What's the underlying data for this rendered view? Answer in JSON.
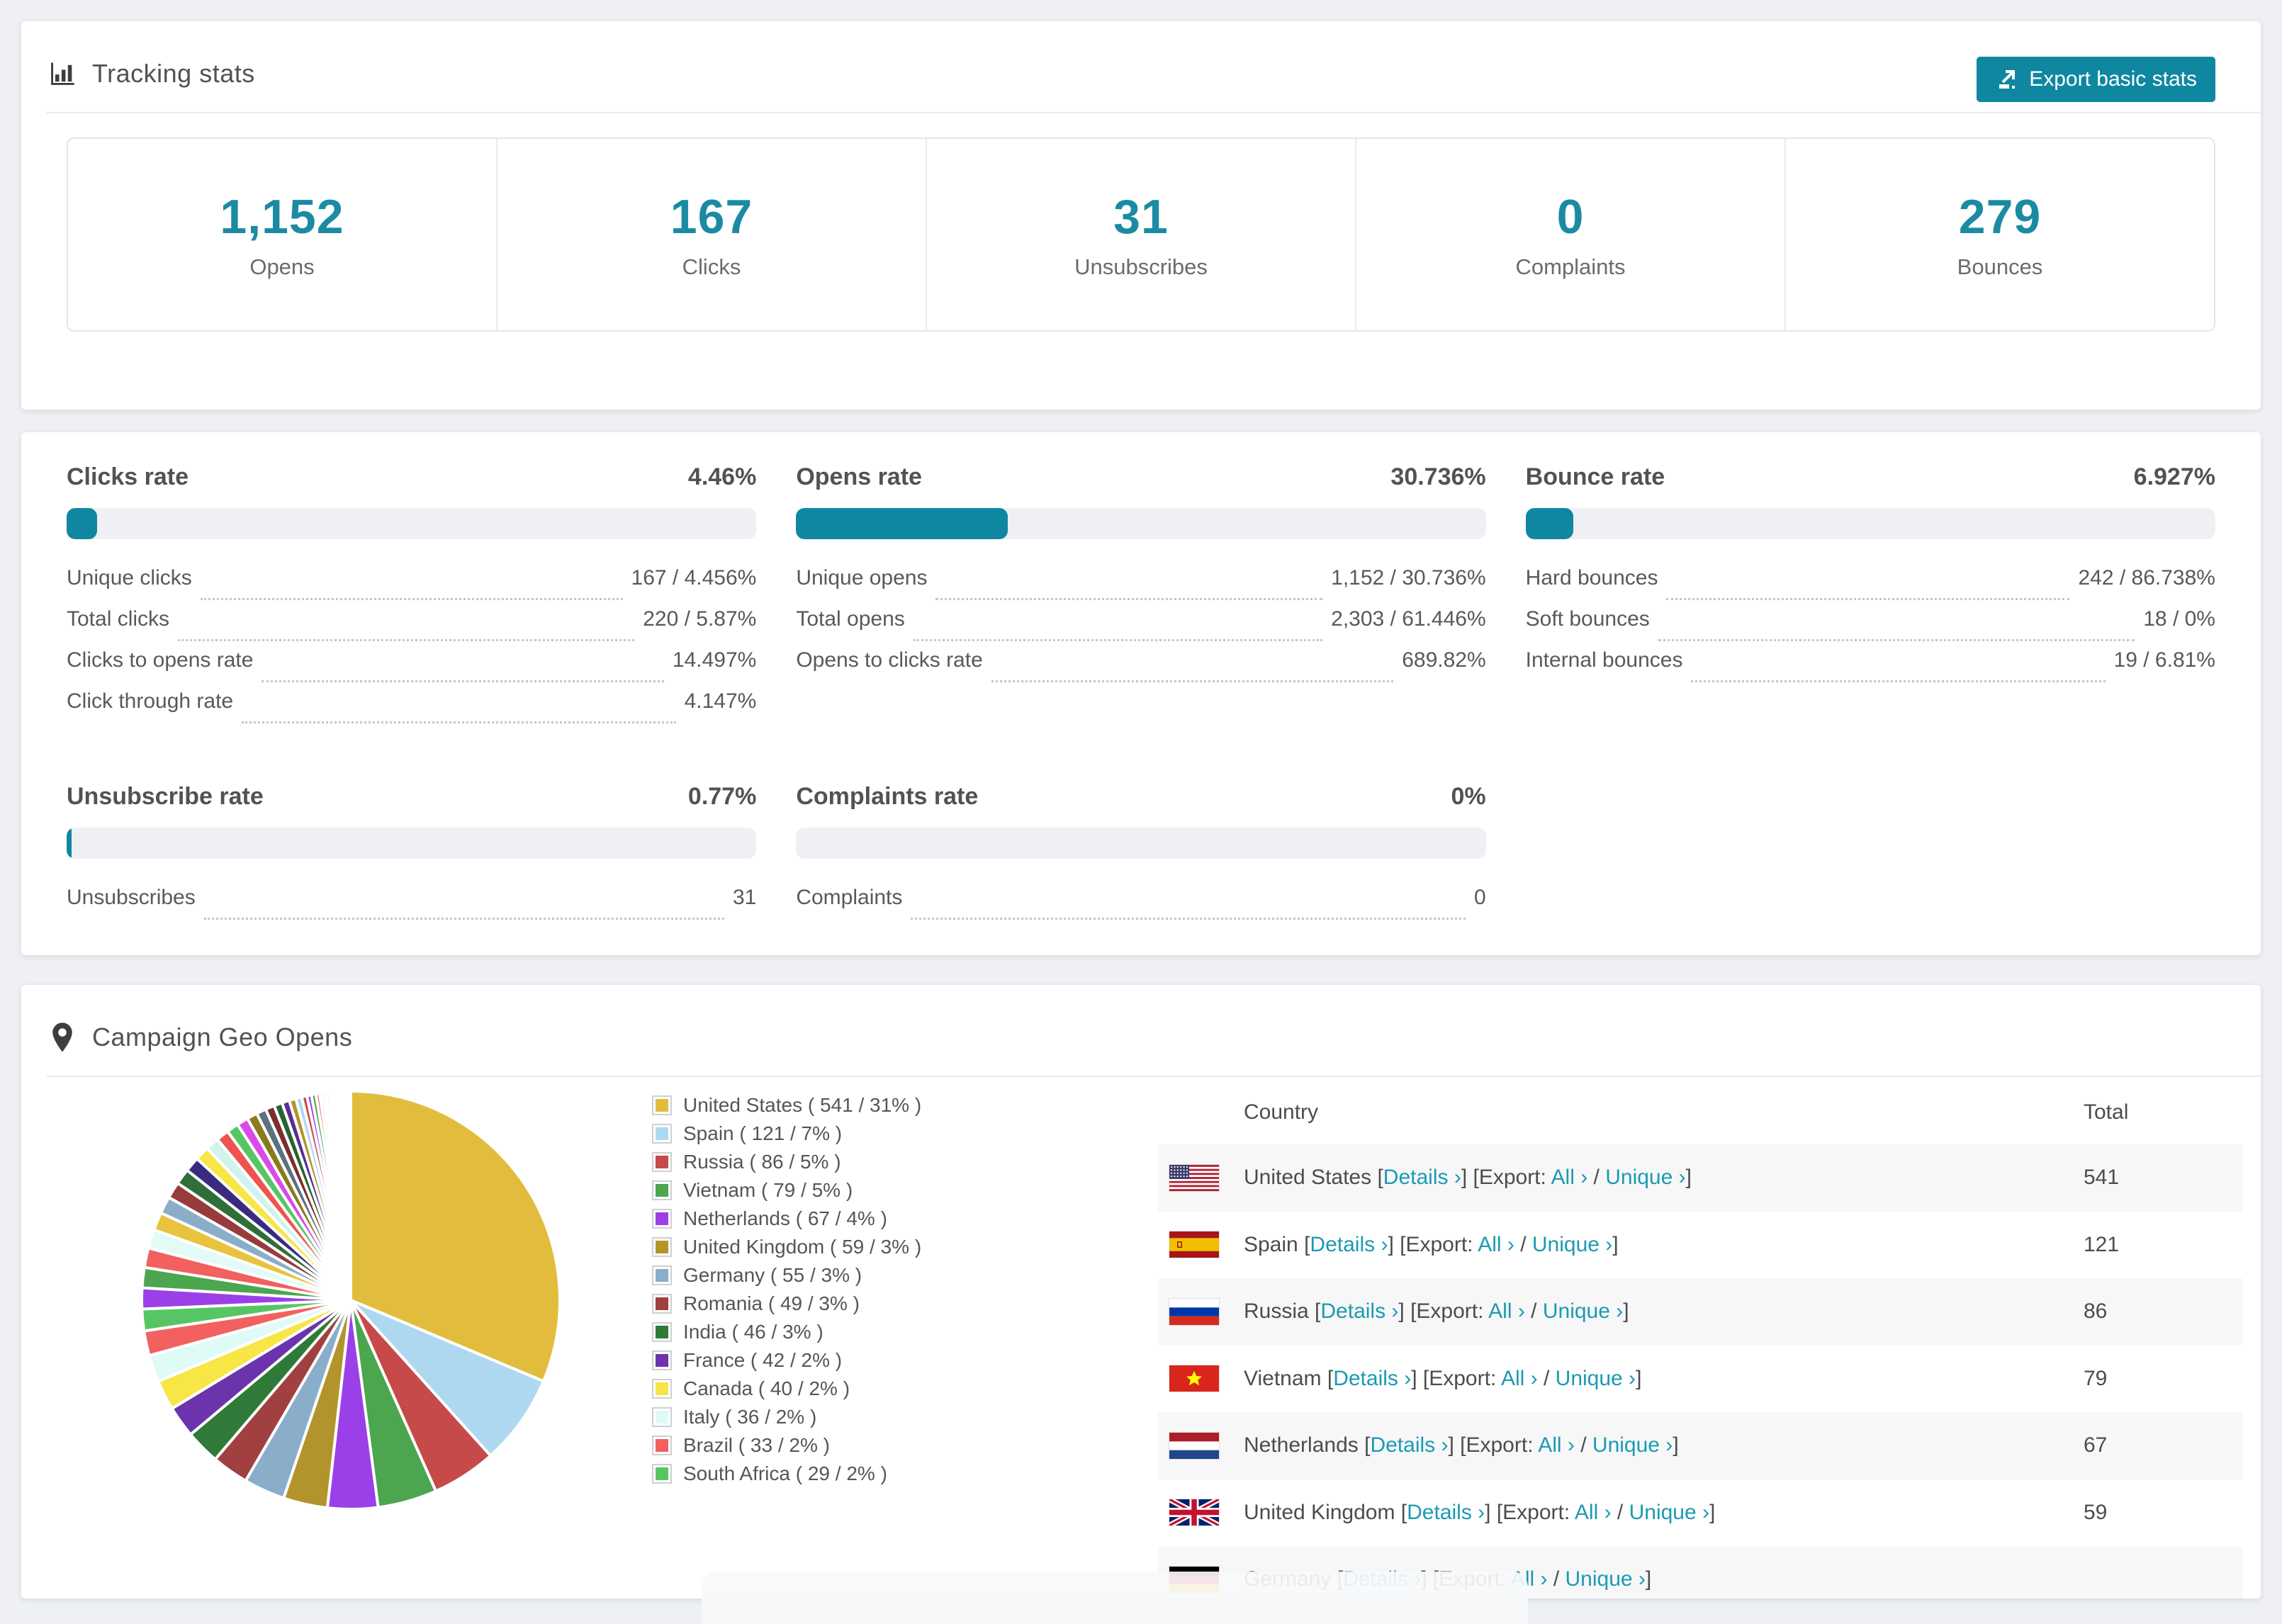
{
  "accent_color": "#0f87a1",
  "link_color": "#1b9ab3",
  "tracking": {
    "title": "Tracking stats",
    "export_button": "Export basic stats",
    "stats": [
      {
        "value": "1,152",
        "label": "Opens"
      },
      {
        "value": "167",
        "label": "Clicks"
      },
      {
        "value": "31",
        "label": "Unsubscribes"
      },
      {
        "value": "0",
        "label": "Complaints"
      },
      {
        "value": "279",
        "label": "Bounces"
      }
    ]
  },
  "rates": {
    "blocks": [
      {
        "id": "clicks-rate",
        "title": "Clicks rate",
        "value": "4.46%",
        "bar_percent": 4.46,
        "rows": [
          {
            "label": "Unique clicks",
            "value": "167 / 4.456%"
          },
          {
            "label": "Total clicks",
            "value": "220 / 5.87%"
          },
          {
            "label": "Clicks to opens rate",
            "value": "14.497%"
          },
          {
            "label": "Click through rate",
            "value": "4.147%"
          }
        ]
      },
      {
        "id": "opens-rate",
        "title": "Opens rate",
        "value": "30.736%",
        "bar_percent": 30.736,
        "rows": [
          {
            "label": "Unique opens",
            "value": "1,152 / 30.736%"
          },
          {
            "label": "Total opens",
            "value": "2,303 / 61.446%"
          },
          {
            "label": "Opens to clicks rate",
            "value": "689.82%"
          }
        ]
      },
      {
        "id": "bounce-rate",
        "title": "Bounce rate",
        "value": "6.927%",
        "bar_percent": 6.927,
        "rows": [
          {
            "label": "Hard bounces",
            "value": "242 / 86.738%"
          },
          {
            "label": "Soft bounces",
            "value": "18 / 0%"
          },
          {
            "label": "Internal bounces",
            "value": "19 / 6.81%"
          }
        ]
      },
      {
        "id": "unsubscribe-rate",
        "title": "Unsubscribe rate",
        "value": "0.77%",
        "bar_percent": 0.77,
        "rows": [
          {
            "label": "Unsubscribes",
            "value": "31"
          }
        ]
      },
      {
        "id": "complaints-rate",
        "title": "Complaints rate",
        "value": "0%",
        "bar_percent": 0,
        "rows": [
          {
            "label": "Complaints",
            "value": "0"
          }
        ]
      }
    ]
  },
  "geo": {
    "title": "Campaign Geo Opens",
    "chart_data": {
      "type": "pie",
      "title": "Campaign Geo Opens",
      "legend_position": "right",
      "start_angle_deg": 0,
      "direction": "clockwise",
      "slices": [
        {
          "label": "United States",
          "value": 541,
          "pct": "31%",
          "color": "#e2bd3d",
          "flag": "us"
        },
        {
          "label": "Spain",
          "value": 121,
          "pct": "7%",
          "color": "#aed8f0",
          "flag": "es"
        },
        {
          "label": "Russia",
          "value": 86,
          "pct": "5%",
          "color": "#c64a4a",
          "flag": "ru"
        },
        {
          "label": "Vietnam",
          "value": 79,
          "pct": "5%",
          "color": "#4ba64f",
          "flag": "vn"
        },
        {
          "label": "Netherlands",
          "value": 67,
          "pct": "4%",
          "color": "#9b40e8",
          "flag": "nl"
        },
        {
          "label": "United Kingdom",
          "value": 59,
          "pct": "3%",
          "color": "#b3932c",
          "flag": "gb"
        },
        {
          "label": "Germany",
          "value": 55,
          "pct": "3%",
          "color": "#8aaec9",
          "flag": "de"
        },
        {
          "label": "Romania",
          "value": 49,
          "pct": "3%",
          "color": "#a04040",
          "flag": "ro"
        },
        {
          "label": "India",
          "value": 46,
          "pct": "3%",
          "color": "#2f7a38",
          "flag": "in"
        },
        {
          "label": "France",
          "value": 42,
          "pct": "2%",
          "color": "#6b34ad",
          "flag": "fr"
        },
        {
          "label": "Canada",
          "value": 40,
          "pct": "2%",
          "color": "#f8e546",
          "flag": "ca"
        },
        {
          "label": "Italy",
          "value": 36,
          "pct": "2%",
          "color": "#dffbf6",
          "flag": "it"
        },
        {
          "label": "Brazil",
          "value": 33,
          "pct": "2%",
          "color": "#f2615f",
          "flag": "br"
        },
        {
          "label": "South Africa",
          "value": 29,
          "pct": "2%",
          "color": "#58c564",
          "flag": "za"
        }
      ],
      "other_slices": {
        "note": "unlabeled long tail of small countries",
        "values": [
          28,
          27,
          26,
          25,
          24,
          23,
          22,
          21,
          20,
          19,
          18,
          17,
          16,
          15,
          14,
          13,
          12,
          11,
          10,
          9,
          8,
          7,
          6,
          6,
          5,
          5,
          4,
          4,
          3,
          3,
          3,
          2,
          2,
          2,
          2,
          1.5,
          1.5,
          1,
          1,
          1,
          0.8,
          0.8,
          0.6,
          0.6,
          0.5,
          0.5,
          0.4,
          0.4,
          0.3,
          0.3
        ],
        "palette": [
          "#9b40e8",
          "#4ba64f",
          "#f2615f",
          "#e3fbf6",
          "#e8c33d",
          "#8aaec9",
          "#963c3c",
          "#2f6e38",
          "#3b2b7e",
          "#f8e546",
          "#d0f4ec",
          "#ef5350",
          "#58c564",
          "#d94ae8",
          "#8a7a1e",
          "#5c7080",
          "#7a2e2e",
          "#27632f",
          "#5a2d91",
          "#b3932c",
          "#aed8f0",
          "#c64a4a"
        ]
      }
    },
    "legend_format": {
      "open": "( ",
      "sep": " / ",
      "close": " )"
    },
    "table": {
      "columns": [
        "Country",
        "Total"
      ],
      "link_labels": {
        "bracket_open": "[",
        "bracket_close": "]",
        "details": "Details ›",
        "export_prefix": "[Export: ",
        "all": "All ›",
        "slash": " / ",
        "unique": "Unique ›"
      },
      "rows": [
        {
          "flag": "us",
          "country": "United States",
          "total": "541"
        },
        {
          "flag": "es",
          "country": "Spain",
          "total": "121"
        },
        {
          "flag": "ru",
          "country": "Russia",
          "total": "86"
        },
        {
          "flag": "vn",
          "country": "Vietnam",
          "total": "79"
        },
        {
          "flag": "nl",
          "country": "Netherlands",
          "total": "67"
        },
        {
          "flag": "gb",
          "country": "United Kingdom",
          "total": "59"
        },
        {
          "flag": "de",
          "country": "Germany",
          "total": ""
        }
      ]
    }
  }
}
